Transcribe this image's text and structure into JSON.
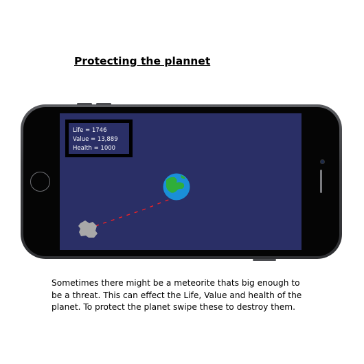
{
  "page": {
    "title": "Protecting the plannet",
    "caption_lines": [
      "Sometimes there might be a meteorite thats big enough to",
      "be a threat. This can effect the Life, Value and health of the",
      "planet. To protect the planet swipe these to destroy them."
    ]
  },
  "game": {
    "stats": {
      "life": "Life = 1746",
      "value": "Value = 13,889",
      "health": "Health = 1000"
    },
    "colors": {
      "screen_background": "#2a2f66",
      "planet_ocean": "#1a8fd8",
      "planet_land": "#2fae3a",
      "meteorite": "#a8a8a8",
      "trajectory": "#ff2020"
    },
    "icons": {
      "planet": "earth-planet-icon",
      "meteorite": "meteorite-icon"
    }
  }
}
